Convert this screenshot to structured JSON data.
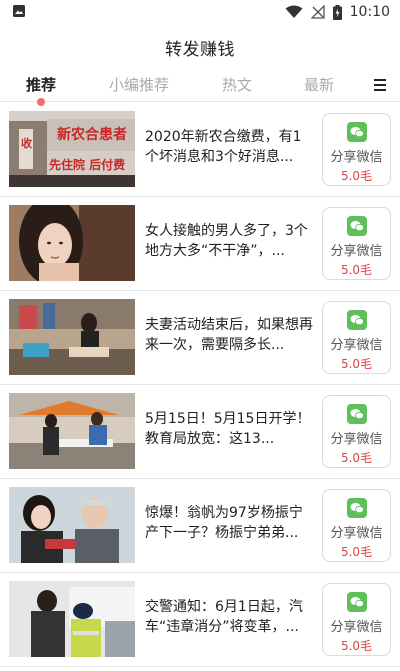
{
  "status_bar": {
    "time": "10:10",
    "icons": [
      "image-icon",
      "wifi-icon",
      "signal-off-icon",
      "battery-charging-icon"
    ]
  },
  "header": {
    "title": "转发赚钱"
  },
  "tabs": [
    {
      "label": "推荐",
      "active": true
    },
    {
      "label": "小编推荐",
      "active": false
    },
    {
      "label": "热文",
      "active": false
    },
    {
      "label": "最新",
      "active": false
    }
  ],
  "menu": {
    "icon": "menu-icon"
  },
  "articles": [
    {
      "title": "2020年新农合缴费，有1个坏消息和3个好消息...",
      "share_label": "分享微信",
      "reward": "5.0毛"
    },
    {
      "title": "女人接触的男人多了，3个地方大多“不干净”，...",
      "share_label": "分享微信",
      "reward": "5.0毛"
    },
    {
      "title": "夫妻活动结束后，如果想再来一次，需要隔多长...",
      "share_label": "分享微信",
      "reward": "5.0毛"
    },
    {
      "title": "5月15日！5月15日开学！教育局放宽：这13...",
      "share_label": "分享微信",
      "reward": "5.0毛"
    },
    {
      "title": "惊爆！翁帆为97岁杨振宁产下一子？杨振宁弟弟...",
      "share_label": "分享微信",
      "reward": "5.0毛"
    },
    {
      "title": "交警通知：6月1日起，汽车“违章消分”将变革，...",
      "share_label": "分享微信",
      "reward": "5.0毛"
    }
  ],
  "colors": {
    "accent_dot": "#f07062",
    "wechat_green": "#5fbf5b",
    "reward_red": "#e04545"
  },
  "thumbnail_illustration_text": [
    "新农合患者",
    "收",
    "先住院 后付费"
  ]
}
